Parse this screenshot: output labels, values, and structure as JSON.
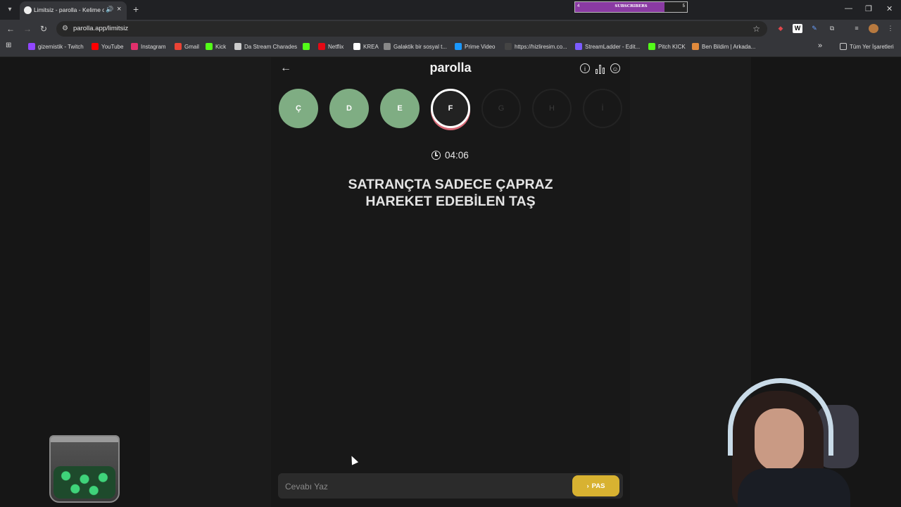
{
  "browser": {
    "tab_title": "Limitsiz - parolla - Kelime o",
    "url": "parolla.app/limitsiz",
    "all_bookmarks": "Tüm Yer İşaretleri"
  },
  "subscriber_bar": {
    "current": "4",
    "label": "SUBSCRIBERS",
    "goal": "5",
    "progress": 0.8
  },
  "bookmarks": [
    {
      "label": "gizemistik - Twitch",
      "color": "#9146ff"
    },
    {
      "label": "YouTube",
      "color": "#ff0000"
    },
    {
      "label": "Instagram",
      "color": "#e1306c"
    },
    {
      "label": "Gmail",
      "color": "#ea4335"
    },
    {
      "label": "Kick",
      "color": "#53fc18"
    },
    {
      "label": "Da Stream Charades",
      "color": "#cccccc"
    },
    {
      "label": "",
      "color": "#53fc18"
    },
    {
      "label": "Netflix",
      "color": "#e50914"
    },
    {
      "label": "KREA",
      "color": "#ffffff"
    },
    {
      "label": "Galaktik bir sosyal t...",
      "color": "#888888"
    },
    {
      "label": "Prime Video",
      "color": "#1a98ff"
    },
    {
      "label": "https://hizliresim.co...",
      "color": "#444444"
    },
    {
      "label": "StreamLadder - Edit...",
      "color": "#7b5cff"
    },
    {
      "label": "Pitch KICK",
      "color": "#53fc18"
    },
    {
      "label": "Ben Bildim | Arkada...",
      "color": "#e08a3c"
    }
  ],
  "game": {
    "logo": "parolla",
    "letters": [
      {
        "letter": "Ç",
        "state": "done"
      },
      {
        "letter": "D",
        "state": "done"
      },
      {
        "letter": "E",
        "state": "done"
      },
      {
        "letter": "F",
        "state": "current"
      },
      {
        "letter": "G",
        "state": "todo"
      },
      {
        "letter": "H",
        "state": "todo"
      },
      {
        "letter": "İ",
        "state": "todo"
      }
    ],
    "timer": "04:06",
    "question_line1": "SATRANÇTA SADECE ÇAPRAZ",
    "question_line2": "HAREKET EDEBİLEN TAŞ",
    "answer_placeholder": "Cevabı Yaz",
    "pass_label": "PAS"
  },
  "colors": {
    "done": "#7fad83",
    "pass_button": "#d8b231",
    "current_ring": "#d86a77"
  }
}
